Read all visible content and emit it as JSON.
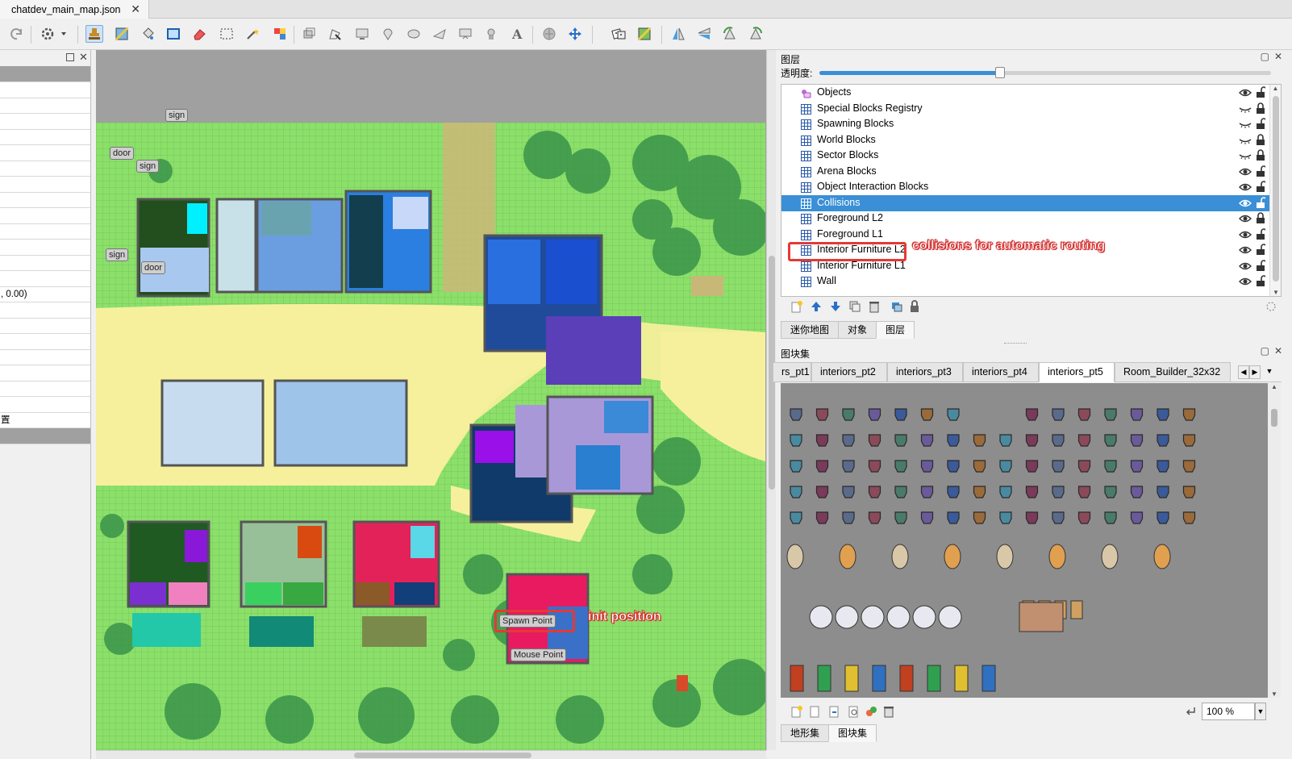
{
  "document_tab": {
    "title": "chatdev_main_map.json"
  },
  "left_panel": {
    "rows": [
      "",
      "",
      "",
      "",
      "",
      "",
      "",
      "",
      "",
      "",
      "",
      "",
      "",
      ", 0.00)",
      "",
      "",
      "",
      "",
      "",
      "",
      "",
      "置"
    ]
  },
  "map": {
    "labels": {
      "sign1": "sign",
      "door1": "door",
      "sign2": "sign",
      "sign3": "sign",
      "door2": "door",
      "spawn": "Spawn Point",
      "mouse": "Mouse Point"
    },
    "annotations": {
      "collisions": "collisions for automatic routing",
      "init": "init position"
    },
    "colors": {
      "grass": "#8be06a",
      "path": "#f4ef9a",
      "highlight": "#e53935"
    }
  },
  "layers_panel": {
    "title": "图层",
    "opacity_label": "透明度:",
    "opacity_value": 0.4,
    "layers": [
      {
        "name": "Objects",
        "type": "object",
        "visible": true,
        "locked": false
      },
      {
        "name": "Special Blocks Registry",
        "type": "tile",
        "visible": false,
        "locked": true
      },
      {
        "name": "Spawning Blocks",
        "type": "tile",
        "visible": false,
        "locked": false
      },
      {
        "name": "World Blocks",
        "type": "tile",
        "visible": false,
        "locked": true
      },
      {
        "name": "Sector Blocks",
        "type": "tile",
        "visible": false,
        "locked": true
      },
      {
        "name": "Arena Blocks",
        "type": "tile",
        "visible": true,
        "locked": false
      },
      {
        "name": "Object Interaction Blocks",
        "type": "tile",
        "visible": true,
        "locked": false
      },
      {
        "name": "Collisions",
        "type": "tile",
        "visible": true,
        "locked": false,
        "selected": true
      },
      {
        "name": "Foreground L2",
        "type": "tile",
        "visible": true,
        "locked": true
      },
      {
        "name": "Foreground L1",
        "type": "tile",
        "visible": true,
        "locked": false
      },
      {
        "name": "Interior Furniture L2",
        "type": "tile",
        "visible": true,
        "locked": false
      },
      {
        "name": "Interior Furniture L1",
        "type": "tile",
        "visible": true,
        "locked": false
      },
      {
        "name": "Wall",
        "type": "tile",
        "visible": true,
        "locked": false
      }
    ],
    "tabs": [
      "迷你地图",
      "对象",
      "图层"
    ],
    "active_tab": "图层"
  },
  "tilesets_panel": {
    "title": "图块集",
    "tabs": [
      "rs_pt1",
      "interiors_pt2",
      "interiors_pt3",
      "interiors_pt4",
      "interiors_pt5",
      "Room_Builder_32x32"
    ],
    "active_tab": "interiors_pt5",
    "zoom": "100 %",
    "bottom_tabs": [
      "地形集",
      "图块集"
    ],
    "active_bottom_tab": "图块集"
  }
}
